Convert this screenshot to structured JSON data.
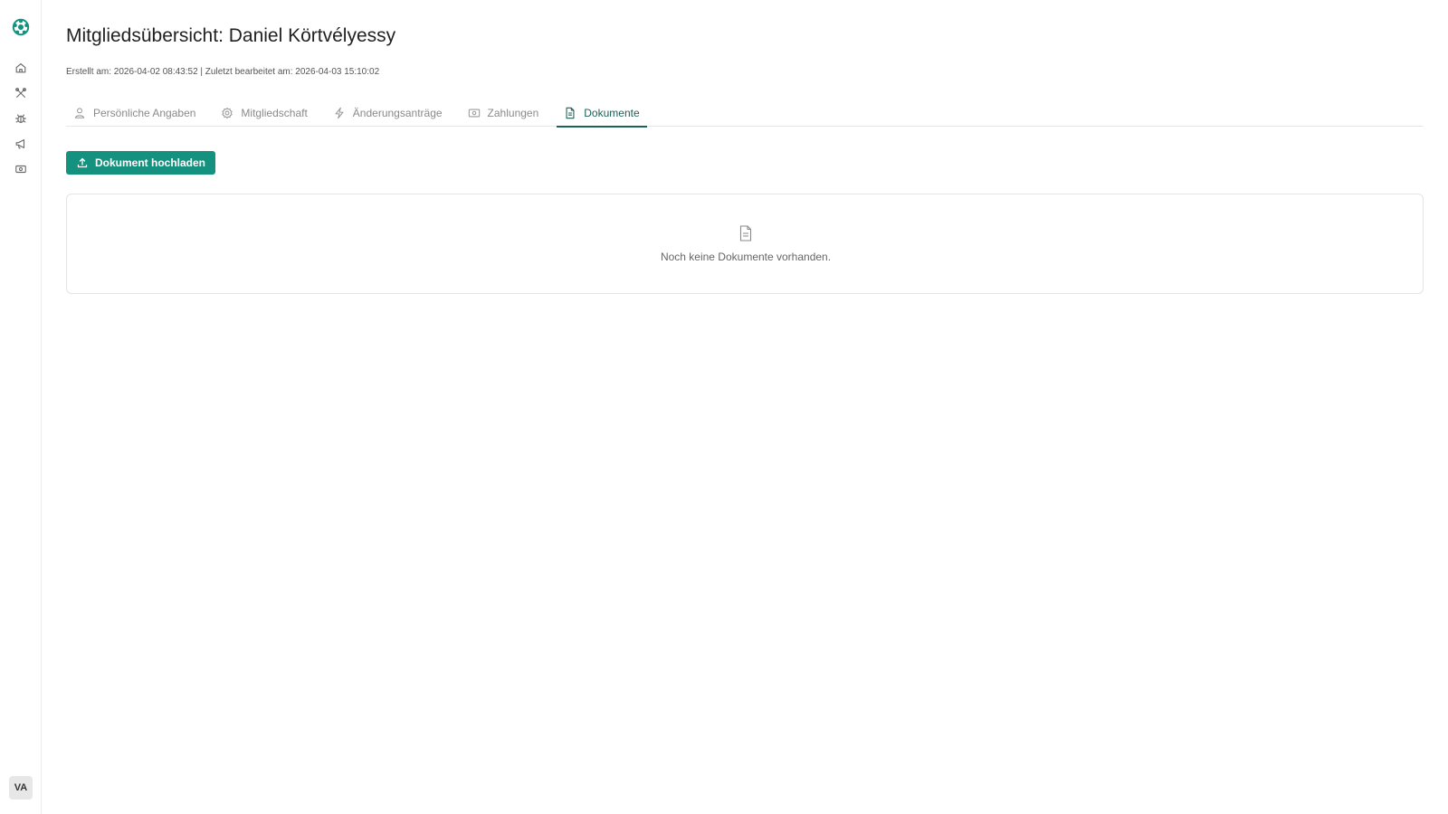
{
  "app": {
    "user_initials": "VA",
    "accent_color": "#14927f",
    "active_tab_color": "#1b5f57"
  },
  "sidebar": {
    "items": [
      {
        "icon": "home-icon"
      },
      {
        "icon": "tools-icon"
      },
      {
        "icon": "bug-icon"
      },
      {
        "icon": "megaphone-icon"
      },
      {
        "icon": "money-icon"
      }
    ]
  },
  "header": {
    "title": "Mitgliedsübersicht: Daniel Körtvélyessy",
    "meta": "Erstellt am: 2026-04-02 08:43:52 | Zuletzt bearbeitet am: 2026-04-03 15:10:02"
  },
  "tabs": [
    {
      "label": "Persönliche Angaben",
      "icon": "user-icon",
      "active": false
    },
    {
      "label": "Mitgliedschaft",
      "icon": "gear-icon",
      "active": false
    },
    {
      "label": "Änderungsanträge",
      "icon": "lightning-icon",
      "active": false
    },
    {
      "label": "Zahlungen",
      "icon": "money-icon",
      "active": false
    },
    {
      "label": "Dokumente",
      "icon": "document-icon",
      "active": true
    }
  ],
  "documents": {
    "upload_label": "Dokument hochladen",
    "empty_text": "Noch keine Dokumente vorhanden."
  }
}
